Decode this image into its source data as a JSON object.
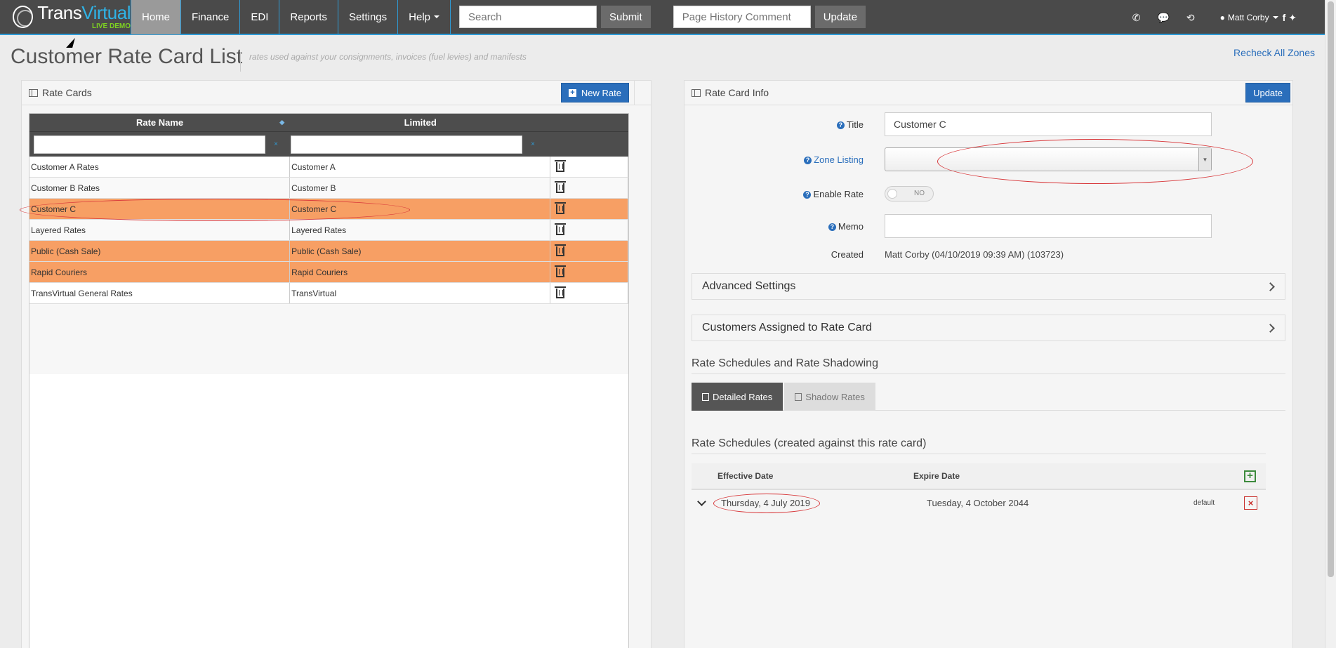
{
  "nav": {
    "logo_main_a": "Trans",
    "logo_main_b": "Virtual",
    "logo_sub": "LIVE DEMO",
    "items": [
      "Home",
      "Finance",
      "EDI",
      "Reports",
      "Settings",
      "Help"
    ],
    "search_placeholder": "Search",
    "submit_label": "Submit",
    "comment_placeholder": "Page History Comment",
    "update_label": "Update",
    "user_name": "Matt Corby"
  },
  "page": {
    "title": "Customer Rate Card List",
    "subtitle": "rates used against your consignments, invoices (fuel levies) and manifests",
    "recheck_label": "Recheck All Zones"
  },
  "rate_cards": {
    "panel_title": "Rate Cards",
    "new_rate_label": "New Rate",
    "columns": [
      "Rate Name",
      "Limited"
    ],
    "rows": [
      {
        "name": "Customer A Rates",
        "limited": "Customer A",
        "highlight": false
      },
      {
        "name": "Customer B Rates",
        "limited": "Customer B",
        "highlight": false
      },
      {
        "name": "Customer C",
        "limited": "Customer C",
        "highlight": true
      },
      {
        "name": "Layered Rates",
        "limited": "Layered Rates",
        "highlight": false
      },
      {
        "name": "Public (Cash Sale)",
        "limited": "Public (Cash Sale)",
        "highlight": true
      },
      {
        "name": "Rapid Couriers",
        "limited": "Rapid Couriers",
        "highlight": true
      },
      {
        "name": "TransVirtual General Rates",
        "limited": "TransVirtual",
        "highlight": false
      }
    ]
  },
  "rate_card_info": {
    "panel_title": "Rate Card Info",
    "update_label": "Update",
    "title_label": "Title",
    "title_value": "Customer C",
    "zone_label": "Zone Listing",
    "zone_value": "",
    "enable_label": "Enable Rate",
    "enable_value": "NO",
    "memo_label": "Memo",
    "memo_value": "",
    "created_label": "Created",
    "created_value": "Matt Corby (04/10/2019 09:39 AM) (103723)",
    "advanced_label": "Advanced Settings",
    "customers_label": "Customers Assigned to Rate Card",
    "schedules_heading": "Rate Schedules and Rate Shadowing",
    "tab_detailed": "Detailed Rates",
    "tab_shadow": "Shadow Rates",
    "schedules_sub": "Rate Schedules (created against this rate card)",
    "col_effective": "Effective Date",
    "col_expire": "Expire Date",
    "schedule_rows": [
      {
        "effective": "Thursday, 4 July 2019",
        "expire": "Tuesday, 4 October 2044",
        "tag": "default"
      }
    ]
  },
  "colors": {
    "accent": "#2a6ebb",
    "highlight_row": "#f79f64",
    "annotation": "#d8373a",
    "navbar": "#4a4a4a"
  }
}
